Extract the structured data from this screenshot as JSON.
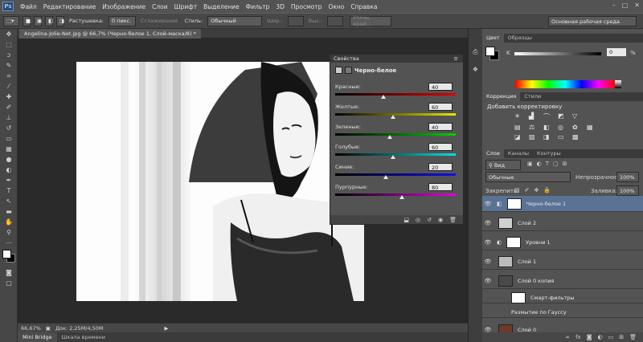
{
  "app": {
    "logo": "Ps"
  },
  "menu": [
    "Файл",
    "Редактирование",
    "Изображение",
    "Слои",
    "Шрифт",
    "Выделение",
    "Фильтр",
    "3D",
    "Просмотр",
    "Окно",
    "Справка"
  ],
  "options": {
    "feather_label": "Растушевка:",
    "feather_value": "0 пикс.",
    "antialias_label": "Сглаживание",
    "style_label": "Стиль:",
    "style_value": "Обычный",
    "width_label": "Шир.:",
    "height_label": "Выс.:",
    "refine_label": "Уточн. край...",
    "workspace": "Основная рабочая среда"
  },
  "document": {
    "tab": "Angelina-Jolie-Net.jpg @ 66,7% (Черно-белое 1, Слой-маска/8) *",
    "zoom": "66,67%",
    "docsize": "Док: 2,25M/4,50M"
  },
  "bottom_tabs": [
    "Mini Bridge",
    "Шкала времени"
  ],
  "properties": {
    "title": "Свойства",
    "subtitle": "Черно-белое",
    "sliders": [
      {
        "label": "Красные:",
        "value": "40",
        "pos": 0.4,
        "grad": "linear-gradient(to right,#000,#e00000)"
      },
      {
        "label": "Желтые:",
        "value": "60",
        "pos": 0.48,
        "grad": "linear-gradient(to right,#000,#e6e600)"
      },
      {
        "label": "Зеленые:",
        "value": "40",
        "pos": 0.45,
        "grad": "linear-gradient(to right,#000,#00d000)"
      },
      {
        "label": "Голубые:",
        "value": "60",
        "pos": 0.48,
        "grad": "linear-gradient(to right,#000,#00e0e0)"
      },
      {
        "label": "Синие:",
        "value": "20",
        "pos": 0.42,
        "grad": "linear-gradient(to right,#000,#1010e8)"
      },
      {
        "label": "Пурпурные:",
        "value": "80",
        "pos": 0.55,
        "grad": "linear-gradient(to right,#000,#e000e0)"
      }
    ]
  },
  "color_panel": {
    "tabs": [
      "Цвет",
      "Образцы"
    ],
    "channel": "K",
    "value": "0",
    "unit": "%"
  },
  "adjustments": {
    "tabs": [
      "Коррекция",
      "Стили"
    ],
    "heading": "Добавить корректировку"
  },
  "layers_panel": {
    "tabs": [
      "Слои",
      "Каналы",
      "Контуры"
    ],
    "filter": "Вид",
    "blend": "Обычные",
    "opacity_label": "Непрозрачность:",
    "opacity": "100%",
    "lock_label": "Закрепить:",
    "fill_label": "Заливка:",
    "fill": "100%",
    "layers": [
      {
        "name": "Черно-белое 1",
        "selected": true
      },
      {
        "name": "Слой 2",
        "selected": false
      },
      {
        "name": "Уровни 1",
        "selected": false
      },
      {
        "name": "Слой 1",
        "selected": false
      },
      {
        "name": "Слой 0 копия",
        "selected": false
      },
      {
        "name": "Смарт-фильтры",
        "selected": false
      },
      {
        "name": "Размытие по Гауссу",
        "selected": false
      },
      {
        "name": "Слой 0",
        "selected": false
      }
    ]
  },
  "colors": {
    "bg": "#535353",
    "panel_dark": "#3a3a3a",
    "selected_layer": "#5a7294",
    "canvas": "#2a2a2a"
  }
}
